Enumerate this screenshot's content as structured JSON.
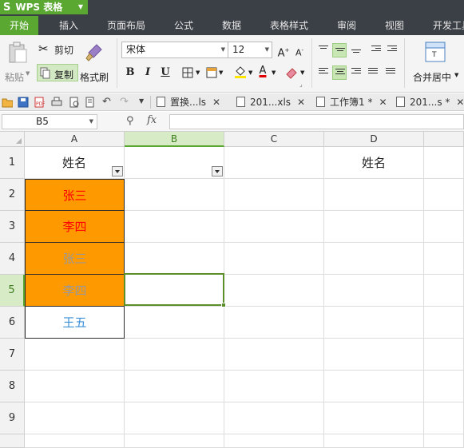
{
  "app": {
    "logo": "S",
    "name": "WPS 表格"
  },
  "menu": {
    "tabs": [
      "开始",
      "插入",
      "页面布局",
      "公式",
      "数据",
      "表格样式",
      "审阅",
      "视图",
      "开发工具"
    ],
    "active_index": 0
  },
  "ribbon": {
    "paste": "粘贴",
    "cut": "剪切",
    "copy": "复制",
    "format_painter": "格式刷",
    "font_name": "宋体",
    "font_size": "12",
    "bold": "B",
    "italic": "I",
    "underline": "U",
    "grow_font": "A",
    "shrink_font": "A",
    "font_color_letter": "A",
    "merge_center": "合并居中"
  },
  "doc_tabs": [
    {
      "label": "置换...ls"
    },
    {
      "label": "201...xls"
    },
    {
      "label": "工作簿1 *"
    },
    {
      "label": "201...s *"
    }
  ],
  "formula_bar": {
    "name_box": "B5",
    "fx": "fx",
    "formula": ""
  },
  "sheet": {
    "columns": [
      "A",
      "B",
      "C",
      "D"
    ],
    "rows": [
      "1",
      "2",
      "3",
      "4",
      "5",
      "6",
      "7",
      "8",
      "9"
    ],
    "selected_column": "B",
    "selected_row": "5",
    "active_cell": "B5",
    "cells": {
      "A1": "姓名",
      "D1": "姓名",
      "A2": "张三",
      "A3": "李四",
      "A4": "张三",
      "A5": "李四",
      "A6": "王五"
    },
    "colors": {
      "highlight_fill": "#ff9900",
      "red_text": "#ff0000",
      "gray_text": "#999999",
      "blue_text": "#3d8fd6",
      "accent": "#5aa832"
    }
  }
}
